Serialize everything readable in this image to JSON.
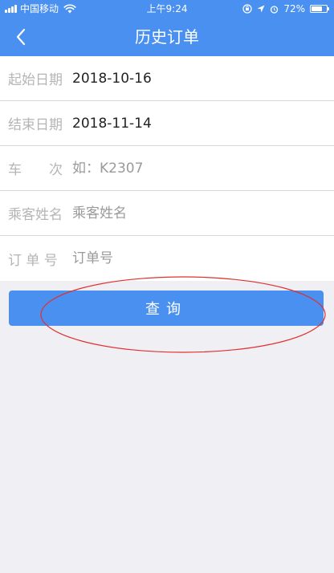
{
  "status_bar": {
    "carrier": "中国移动",
    "time": "上午9:24",
    "battery_percent": "72%",
    "battery_level": 0.72,
    "icons": [
      "signal-icon",
      "wifi-icon",
      "location-icon",
      "alarm-icon",
      "orientation-lock-icon",
      "battery-icon"
    ]
  },
  "navbar": {
    "title": "历史订单",
    "back_icon": "chevron-left-icon"
  },
  "form": {
    "fields": [
      {
        "label": "起始日期",
        "value": "2018-10-16",
        "placeholder": ""
      },
      {
        "label": "结束日期",
        "value": "2018-11-14",
        "placeholder": ""
      },
      {
        "label": "车　　次",
        "value": "",
        "placeholder": "如：K2307"
      },
      {
        "label": "乘客姓名",
        "value": "",
        "placeholder": "乘客姓名"
      },
      {
        "label": "订 单 号",
        "value": "",
        "placeholder": "订单号"
      }
    ]
  },
  "query_button": {
    "label": "查询"
  },
  "colors": {
    "primary": "#4a90f0",
    "background": "#efeff4",
    "annotation": "#e03030"
  }
}
